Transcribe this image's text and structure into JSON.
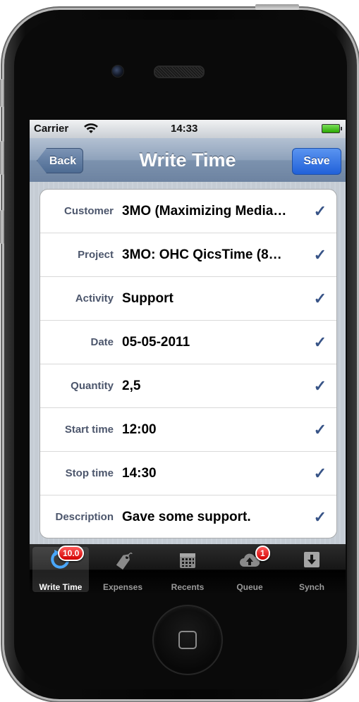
{
  "status_bar": {
    "carrier": "Carrier",
    "time": "14:33"
  },
  "nav": {
    "back_label": "Back",
    "title": "Write Time",
    "save_label": "Save"
  },
  "form": {
    "rows": [
      {
        "label": "Customer",
        "value": "3MO (Maximizing Media…"
      },
      {
        "label": "Project",
        "value": "3MO: OHC QicsTime (8…"
      },
      {
        "label": "Activity",
        "value": "Support"
      },
      {
        "label": "Date",
        "value": "05-05-2011"
      },
      {
        "label": "Quantity",
        "value": "2,5"
      },
      {
        "label": "Start time",
        "value": "12:00"
      },
      {
        "label": "Stop time",
        "value": "14:30"
      },
      {
        "label": "Description",
        "value": "Gave some support."
      }
    ],
    "check_glyph": "✓"
  },
  "tabs": [
    {
      "label": "Write Time",
      "icon": "clock-arrow-icon",
      "badge": "10.0",
      "active": true
    },
    {
      "label": "Expenses",
      "icon": "price-tag-icon",
      "badge": ""
    },
    {
      "label": "Recents",
      "icon": "calendar-icon",
      "badge": ""
    },
    {
      "label": "Queue",
      "icon": "cloud-upload-icon",
      "badge": "1"
    },
    {
      "label": "Synch",
      "icon": "download-arrow-icon",
      "badge": ""
    }
  ],
  "colors": {
    "nav_bar": "#7c92ae",
    "save_button": "#2161d9",
    "label_text": "#4c566c",
    "check_mark": "#385487",
    "badge": "#d10000"
  }
}
